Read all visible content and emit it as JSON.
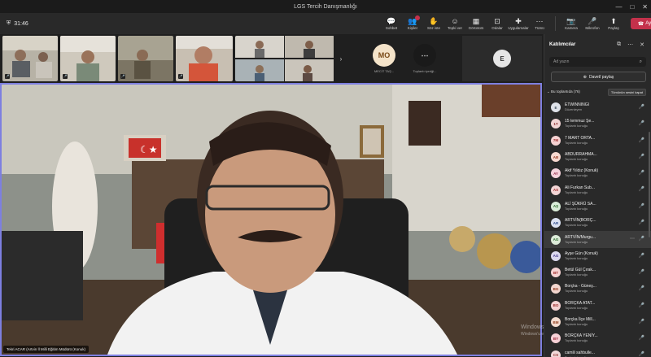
{
  "window": {
    "title": "LGS Tercih Danışmanlığı",
    "minimize": "—",
    "maximize": "□",
    "close": "✕"
  },
  "toolbar": {
    "timer": "31:46",
    "tools": [
      {
        "label": "Sohbet",
        "icon": "chat-icon",
        "glyph": "💬",
        "active": false
      },
      {
        "label": "Kişiler",
        "icon": "people-icon",
        "glyph": "👥",
        "active": true,
        "badge": ""
      },
      {
        "label": "Söz iste",
        "icon": "raise-hand-icon",
        "glyph": "✋",
        "active": false
      },
      {
        "label": "Tepki ver",
        "icon": "react-icon",
        "glyph": "☺",
        "active": false
      },
      {
        "label": "Görünüm",
        "icon": "view-icon",
        "glyph": "▦",
        "active": false
      },
      {
        "label": "Odalar",
        "icon": "rooms-icon",
        "glyph": "⊡",
        "active": false
      },
      {
        "label": "Uygulamalar",
        "icon": "apps-icon",
        "glyph": "✚",
        "active": false
      },
      {
        "label": "Tümü",
        "icon": "more-icon",
        "glyph": "⋯",
        "active": false
      }
    ],
    "media": [
      {
        "label": "Kamera",
        "icon": "camera-off-icon",
        "glyph": "📷"
      },
      {
        "label": "Mikrofon",
        "icon": "mic-off-icon",
        "glyph": "🎤"
      },
      {
        "label": "Paylaş",
        "icon": "share-icon",
        "glyph": "⬆"
      }
    ],
    "leave": {
      "label": "Ayrıl",
      "icon": "phone-icon",
      "glyph": "☎"
    }
  },
  "thumbnails": {
    "avatars": [
      {
        "initials": "MO",
        "label": "MECİT TAŞ...",
        "bg": "#f4e3c9",
        "fg": "#7a4a17"
      },
      {
        "initials": "⋯",
        "label": "Toplantı içeriği...",
        "bg": "#1a1a1a",
        "fg": "#cccccc"
      }
    ],
    "extra_initial": "E"
  },
  "stage": {
    "name_tag": "Tekri ACAR (Artvin İl Milli Eğitim Müdürü (Konuk)"
  },
  "watermark": {
    "line1": "Windows'u Etkinleştir",
    "line2": "Windows'u etkinleştirmek için Ayarlar'a gidin."
  },
  "panel": {
    "title": "Katılımcılar",
    "search_placeholder": "Ad yazın",
    "share_label": "Davetî paylaş",
    "section_label": "Bu toplantıda (76)",
    "mute_all": "Tümünün sesini kapat",
    "participants": [
      {
        "initials": "E",
        "name": "ETWINNINGI",
        "role": "Düzenleyen",
        "bg": "#dfe3ea",
        "fg": "#3a4a5a"
      },
      {
        "initials": "1T",
        "name": "15 temmuz Şe...",
        "role": "Toplantı konuğu",
        "bg": "#f2d6d6",
        "fg": "#8a2c2c"
      },
      {
        "initials": "7M",
        "name": "7 MART ORTA...",
        "role": "Toplantı konuğu",
        "bg": "#f6d2d2",
        "fg": "#9c2a2a"
      },
      {
        "initials": "AB",
        "name": "ABDURRAHMA...",
        "role": "Toplantı konuğu",
        "bg": "#f8d9d0",
        "fg": "#9a3a22"
      },
      {
        "initials": "AY",
        "name": "Akif Yıldız (Konuk)",
        "role": "Toplantı konuğu",
        "bg": "#f6d4dd",
        "fg": "#962a48"
      },
      {
        "initials": "AS",
        "name": "Ali Furkan Sub...",
        "role": "Toplantı konuğu",
        "bg": "#f3d5d5",
        "fg": "#a02c2c"
      },
      {
        "initials": "AŞ",
        "name": "ALİ ŞÜKRÜ SA...",
        "role": "Toplantı konuğu",
        "bg": "#d9ecd8",
        "fg": "#2b6a2b"
      },
      {
        "initials": "AR",
        "name": "ARTVİN(BORÇ...",
        "role": "Toplantı konuğu",
        "bg": "#dbe2f3",
        "fg": "#2e4b8c"
      },
      {
        "initials": "AG",
        "name": "ARTVİN/Murgu...",
        "role": "Toplantı konuğu",
        "bg": "#dcebd9",
        "fg": "#2e6a2e",
        "highlight": true
      },
      {
        "initials": "AG",
        "name": "Ayşe Gün (Konuk)",
        "role": "Toplantı konuğu",
        "bg": "#dcdaf0",
        "fg": "#43378c"
      },
      {
        "initials": "BT",
        "name": "Betül Gül Çırak...",
        "role": "Toplantı konuğu",
        "bg": "#f6d3d3",
        "fg": "#a02828"
      },
      {
        "initials": "BG",
        "name": "Borçka - Güneş...",
        "role": "Toplantı konuğu",
        "bg": "#f2d6cf",
        "fg": "#94391f"
      },
      {
        "initials": "BO",
        "name": "BORÇKA ATAT...",
        "role": "Toplantı konuğu",
        "bg": "#f5d3d3",
        "fg": "#9c2b2b"
      },
      {
        "initials": "BM",
        "name": "Borçka İlçe Mill...",
        "role": "Toplantı konuğu",
        "bg": "#f4dcd0",
        "fg": "#934121"
      },
      {
        "initials": "BY",
        "name": "BORÇKA YENİY...",
        "role": "Toplantı konuğu",
        "bg": "#f6d0d6",
        "fg": "#9e2538"
      },
      {
        "initials": "CS",
        "name": "camili sahbulle...",
        "role": "Toplantı konuğu",
        "bg": "#f1d8d8",
        "fg": "#912e2e"
      }
    ]
  },
  "colors": {
    "accent": "#7d7fe0",
    "leave": "#c4314b",
    "panel_bg": "#292929"
  }
}
